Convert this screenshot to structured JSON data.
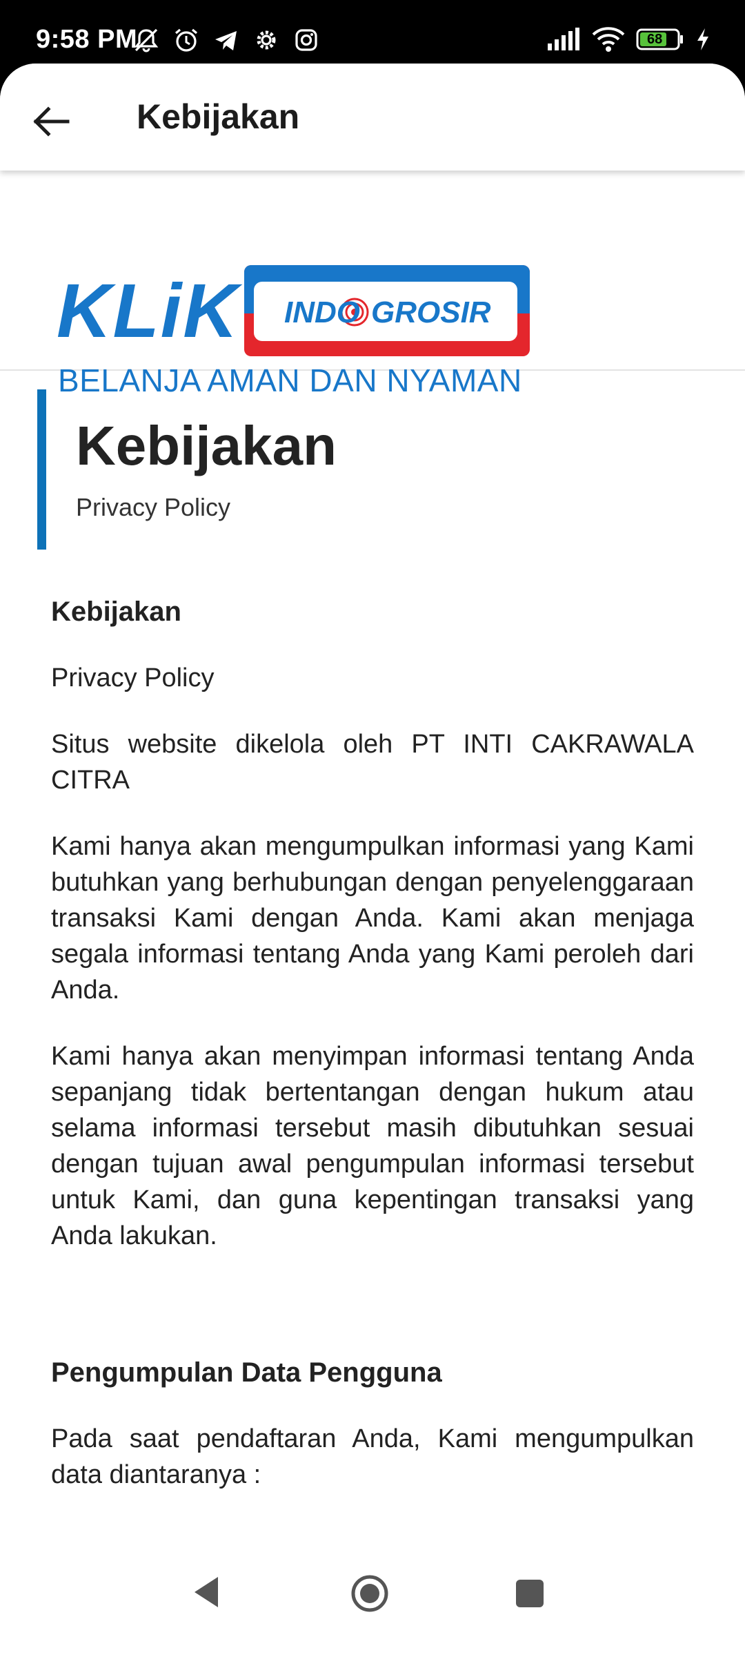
{
  "status_bar": {
    "time": "9:58 PM",
    "battery": "68",
    "icons": [
      "mute-bell-icon",
      "alarm-icon",
      "telegram-icon",
      "settings-icon",
      "instagram-icon",
      "signal-icon",
      "wifi-icon",
      "battery-icon",
      "charging-icon"
    ]
  },
  "appbar": {
    "title": "Kebijakan",
    "back_icon": "arrow-left-icon"
  },
  "banner": {
    "logo_klik": "KLiK",
    "logo_brand_left": "INDO",
    "logo_brand_right": "GROSIR",
    "tagline": "BELANJA AMAN DAN NYAMAN",
    "colors": {
      "blue": "#1877c9",
      "red": "#e4262c"
    }
  },
  "heading": {
    "title": "Kebijakan",
    "subtitle": "Privacy Policy",
    "accent_color": "#0d72b8"
  },
  "content": {
    "heading1": "Kebijakan",
    "p1": "Privacy Policy",
    "p2": "Situs website dikelola oleh PT INTI CAKRAWALA CITRA",
    "p3": "Kami hanya akan mengumpulkan informasi yang Kami butuhkan yang berhubungan dengan penyelenggaraan transaksi Kami dengan Anda. Kami akan menjaga segala informasi tentang Anda yang Kami peroleh dari Anda.",
    "p4": "Kami hanya akan menyimpan informasi tentang Anda sepanjang tidak bertentangan dengan hukum atau selama informasi tersebut masih dibutuhkan sesuai dengan tujuan awal pengumpulan informasi tersebut untuk Kami, dan guna kepentingan transaksi yang Anda lakukan.",
    "heading2": "Pengumpulan Data Pengguna",
    "p5": "Pada saat pendaftaran Anda, Kami mengumpulkan data diantaranya :"
  },
  "navbar": {
    "icons": [
      "nav-back-icon",
      "nav-home-icon",
      "nav-recents-icon"
    ]
  }
}
